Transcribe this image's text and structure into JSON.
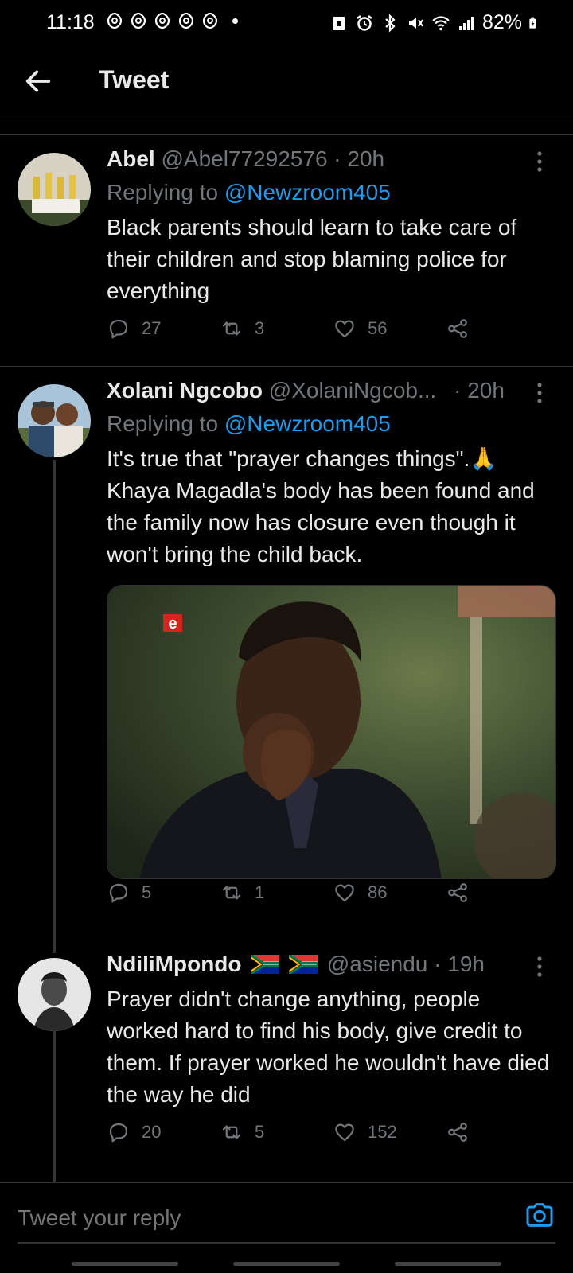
{
  "status_bar": {
    "time": "11:18",
    "battery": "82%"
  },
  "header": {
    "title": "Tweet"
  },
  "tweets": [
    {
      "name": "Abel",
      "handle": "@Abel77292576",
      "time": "· 20h",
      "replying_prefix": "Replying to",
      "mention": "@Newzroom405",
      "text": "Black parents should learn to take care of their children and stop blaming police for everything",
      "replies": "27",
      "retweets": "3",
      "likes": "56"
    },
    {
      "name": "Xolani Ngcobo",
      "handle": "@XolaniNgcob...",
      "time": "· 20h",
      "replying_prefix": "Replying to",
      "mention": "@Newzroom405",
      "text": "It's true that \"prayer changes things\".🙏 Khaya Magadla's body has been found and the family now has closure even though it won't bring the child back.",
      "media_badge": "e",
      "replies": "5",
      "retweets": "1",
      "likes": "86"
    },
    {
      "name": "NdiliMpondo",
      "handle": "@asiendu",
      "time": "· 19h",
      "text": "Prayer didn't change anything, people worked hard to find his body, give credit to them. If prayer worked he wouldn't have died the way he did",
      "replies": "20",
      "retweets": "5",
      "likes": "152"
    }
  ],
  "reply_bar": {
    "placeholder": "Tweet your reply"
  },
  "colors": {
    "background": "#000000",
    "text": "#e7e9ea",
    "secondary": "#71767b",
    "accent": "#1d9bf0"
  }
}
